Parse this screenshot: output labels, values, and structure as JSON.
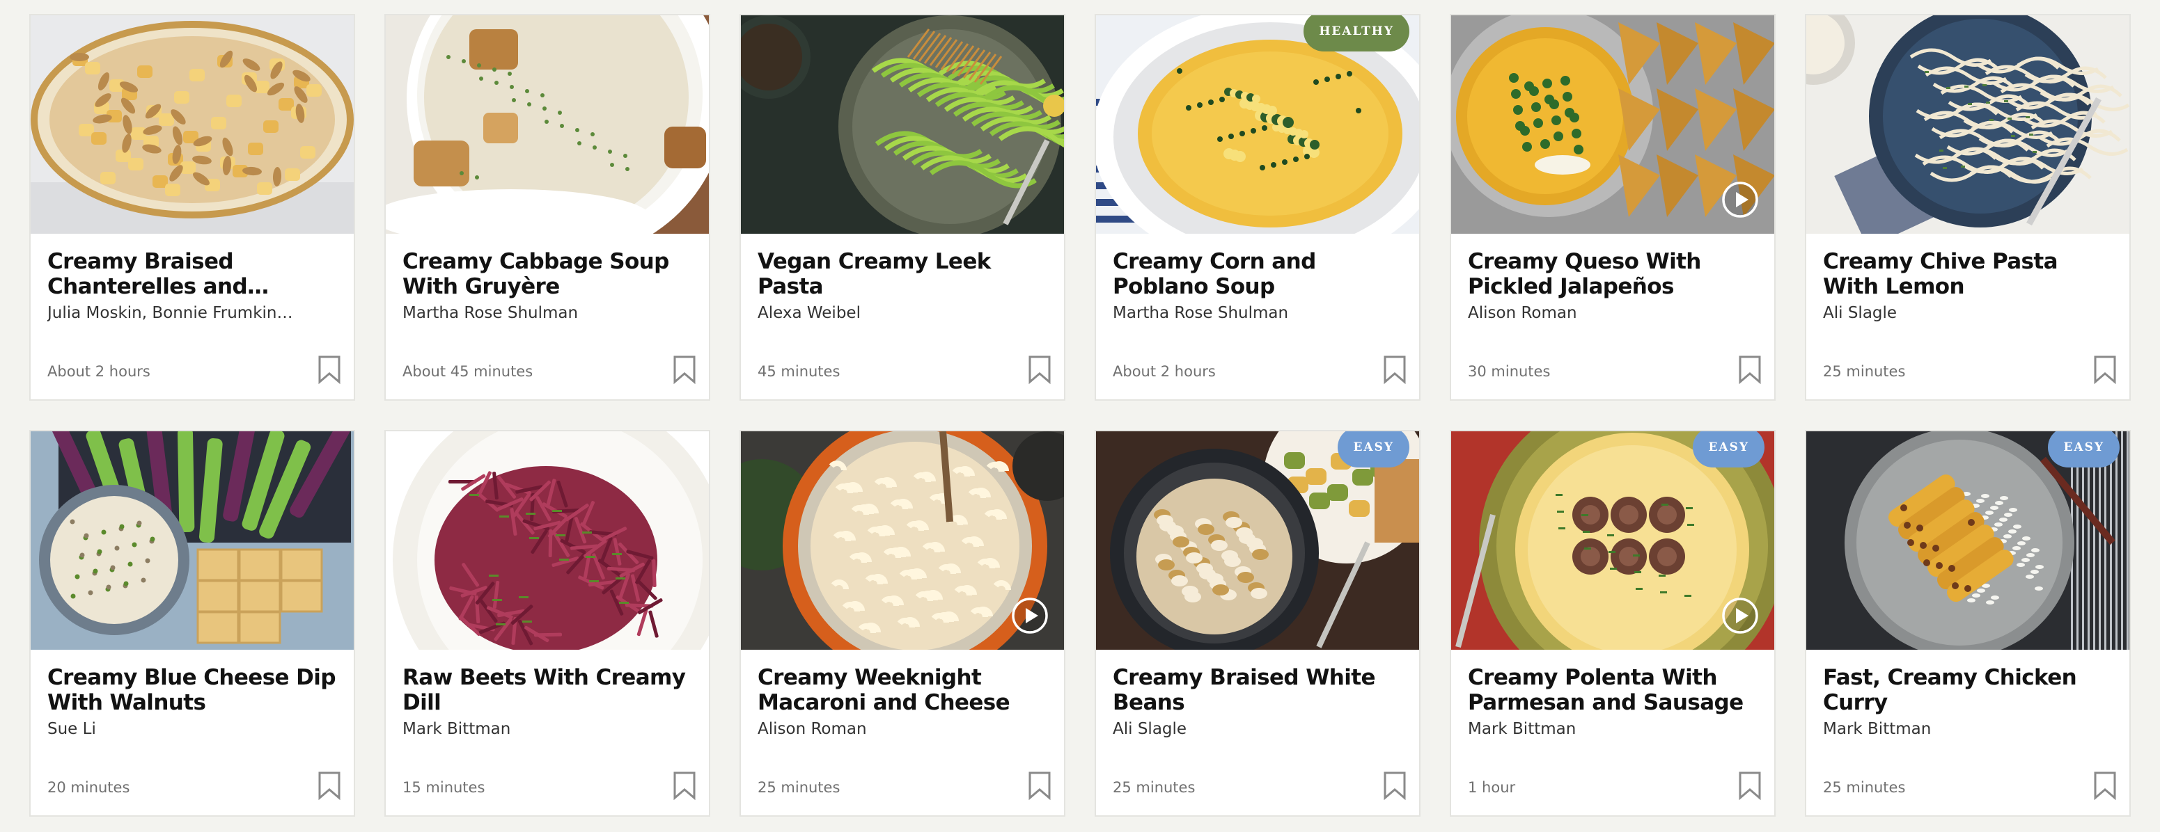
{
  "cards": [
    {
      "title": "Creamy Braised Chanterelles and Potatoes",
      "author": "Julia Moskin, Bonnie Frumkin…",
      "time": "About 2 hours",
      "badge": "",
      "video": false,
      "art": "chanterelles"
    },
    {
      "title": "Creamy Cabbage Soup With Gruyère",
      "author": "Martha Rose Shulman",
      "time": "About 45 minutes",
      "badge": "",
      "video": false,
      "art": "cabbage-soup"
    },
    {
      "title": "Vegan Creamy Leek Pasta",
      "author": "Alexa Weibel",
      "time": "45 minutes",
      "badge": "",
      "video": false,
      "art": "leek-pasta"
    },
    {
      "title": "Creamy Corn and Poblano Soup",
      "author": "Martha Rose Shulman",
      "time": "About 2 hours",
      "badge": "HEALTHY",
      "video": false,
      "art": "corn-soup"
    },
    {
      "title": "Creamy Queso With Pickled Jalapeños",
      "author": "Alison Roman",
      "time": "30 minutes",
      "badge": "",
      "video": true,
      "art": "queso"
    },
    {
      "title": "Creamy Chive Pasta With Lemon",
      "author": "Ali Slagle",
      "time": "25 minutes",
      "badge": "",
      "video": false,
      "art": "chive-pasta"
    },
    {
      "title": "Creamy Blue Cheese Dip With Walnuts",
      "author": "Sue Li",
      "time": "20 minutes",
      "badge": "",
      "video": false,
      "art": "blue-cheese-dip"
    },
    {
      "title": "Raw Beets With Creamy Dill",
      "author": "Mark Bittman",
      "time": "15 minutes",
      "badge": "",
      "video": false,
      "art": "beets"
    },
    {
      "title": "Creamy Weeknight Macaroni and Cheese",
      "author": "Alison Roman",
      "time": "25 minutes",
      "badge": "",
      "video": true,
      "art": "mac-cheese"
    },
    {
      "title": "Creamy Braised White Beans",
      "author": "Ali Slagle",
      "time": "25 minutes",
      "badge": "EASY",
      "video": false,
      "art": "white-beans"
    },
    {
      "title": "Creamy Polenta With Parmesan and Sausage",
      "author": "Mark Bittman",
      "time": "1 hour",
      "badge": "EASY",
      "video": true,
      "art": "polenta"
    },
    {
      "title": "Fast, Creamy Chicken Curry",
      "author": "Mark Bittman",
      "time": "25 minutes",
      "badge": "EASY",
      "video": false,
      "art": "chicken-curry"
    }
  ],
  "badge_colors": {
    "HEALTHY": "#6d8a4a",
    "EASY": "#6f9bd3"
  },
  "icons": {
    "save": "bookmark-icon",
    "play": "play-icon"
  }
}
